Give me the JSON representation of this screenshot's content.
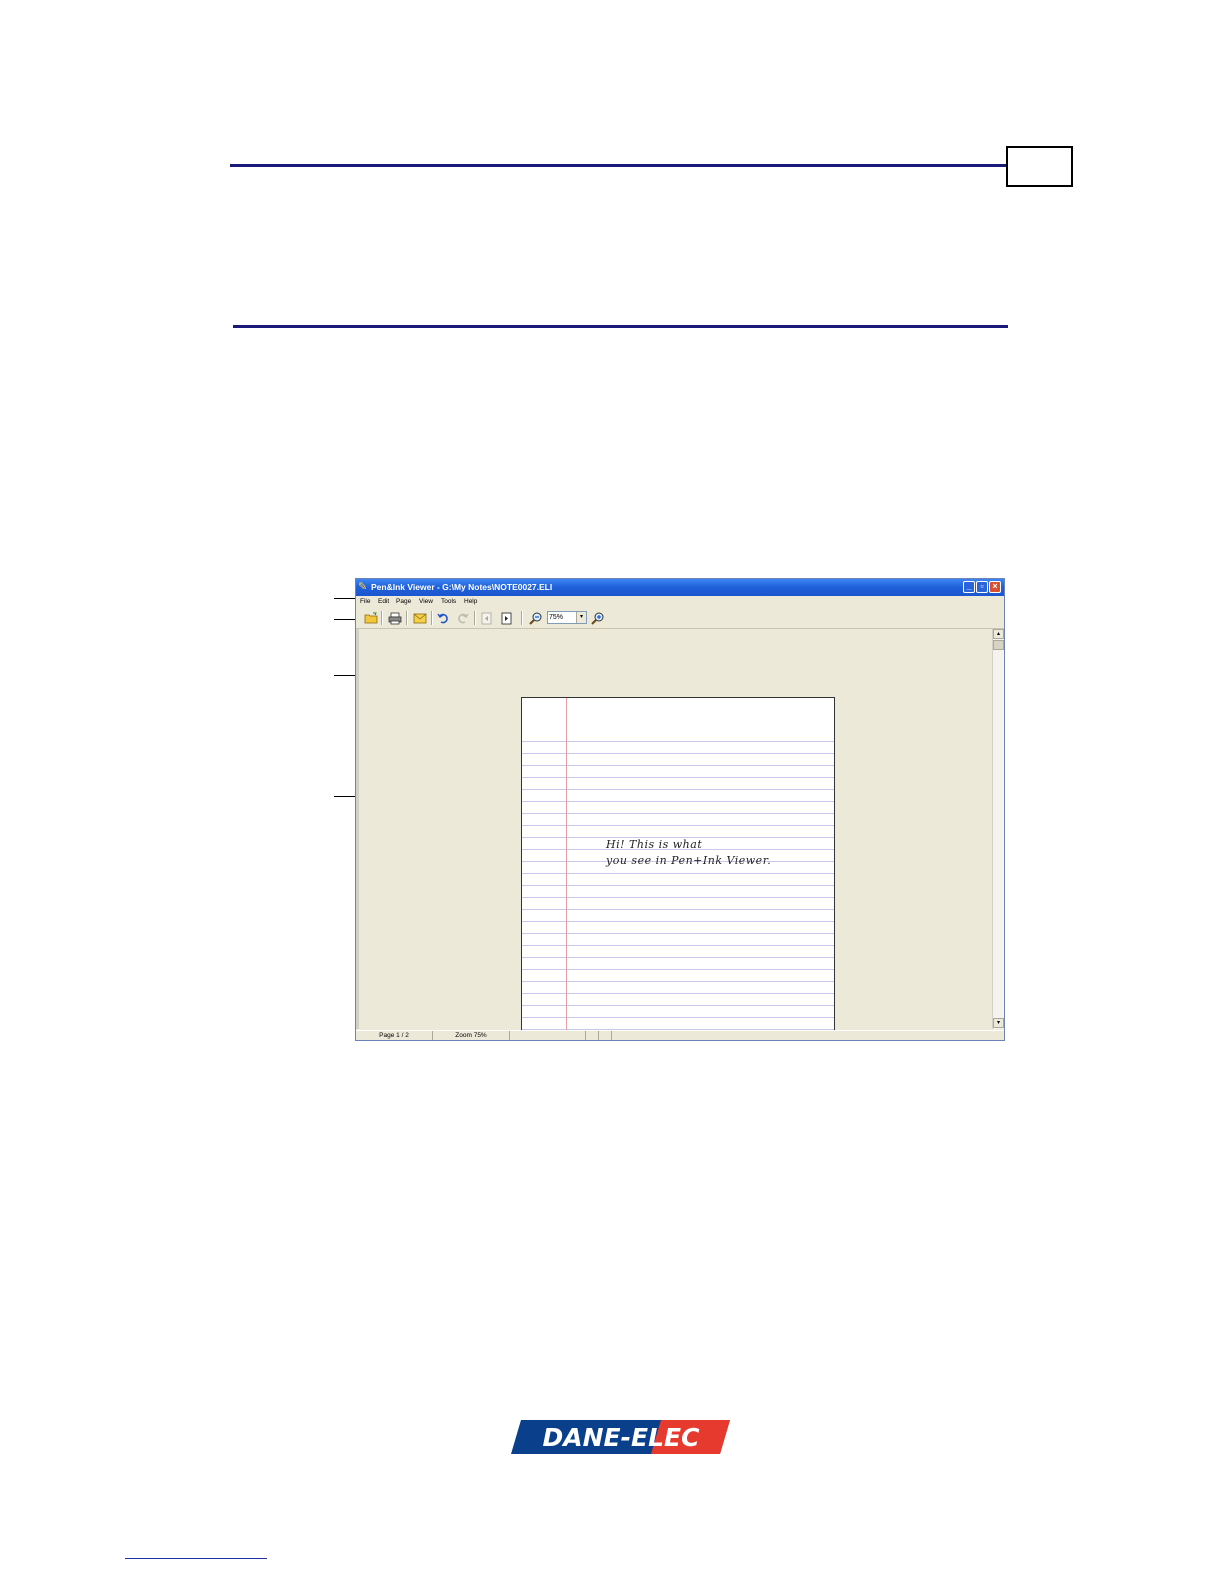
{
  "window": {
    "title": "Pen&Ink Viewer - G:\\My Notes\\NOTE0027.ELI",
    "minimize_glyph": "_",
    "maximize_glyph": "▫",
    "close_glyph": "×"
  },
  "menu": {
    "file": "File",
    "edit": "Edit",
    "page": "Page",
    "view": "View",
    "tools": "Tools",
    "help": "Help"
  },
  "toolbar": {
    "zoom_value": "75%",
    "zoom_arrow": "▾"
  },
  "scrollbar": {
    "up": "▴",
    "down": "▾"
  },
  "note": {
    "line1": "Hi! This is what",
    "line2": "you see in Pen+Ink Viewer."
  },
  "status": {
    "page": "Page 1 / 2",
    "zoom": "Zoom 75%"
  },
  "logo": {
    "text": "DANE-ELEC",
    "bg_color": "#0a3f8c",
    "accent_color": "#e63a2e"
  },
  "icons": {
    "open": "open-folder-icon",
    "print": "print-icon",
    "email": "email-icon",
    "undo": "undo-icon",
    "redo": "redo-icon",
    "prev_page": "previous-page-icon",
    "next_page": "next-page-icon",
    "zoom_out": "zoom-out-icon",
    "zoom_in": "zoom-in-icon"
  }
}
